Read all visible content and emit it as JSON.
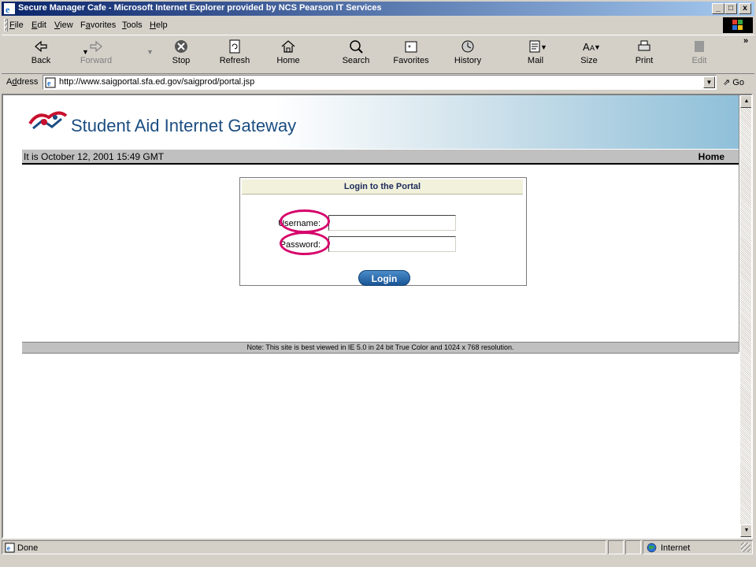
{
  "window": {
    "title": "Secure Manager Cafe - Microsoft Internet Explorer provided by NCS Pearson IT Services",
    "min": "_",
    "max": "□",
    "close": "x"
  },
  "menu": [
    {
      "label": "File",
      "accel": "F",
      "rest": "ile"
    },
    {
      "label": "Edit",
      "accel": "E",
      "rest": "dit"
    },
    {
      "label": "View",
      "accel": "V",
      "rest": "iew"
    },
    {
      "label": "Favorites",
      "accel": "a",
      "pre": "F",
      "rest": "vorites"
    },
    {
      "label": "Tools",
      "accel": "T",
      "rest": "ools"
    },
    {
      "label": "Help",
      "accel": "H",
      "rest": "elp"
    }
  ],
  "toolbar": {
    "back": "Back",
    "forward": "Forward",
    "stop": "Stop",
    "refresh": "Refresh",
    "home": "Home",
    "search": "Search",
    "favorites": "Favorites",
    "history": "History",
    "mail": "Mail",
    "size": "Size",
    "print": "Print",
    "edit": "Edit",
    "more": "»"
  },
  "address": {
    "label_pre": "A",
    "label_accel": "d",
    "label_post": "dress",
    "url": "http://www.saigportal.sfa.ed.gov/saigprod/portal.jsp",
    "go": "Go"
  },
  "site": {
    "title": "Student Aid Internet Gateway",
    "date": "It is October 12, 2001 15:49 GMT",
    "home": "Home"
  },
  "login": {
    "heading": "Login to the Portal",
    "username_label": "Username:",
    "password_label": "Password:",
    "username_value": "",
    "password_value": "",
    "button": "Login"
  },
  "note": "Note: This site is best viewed in IE 5.0 in 24 bit True Color and 1024 x 768 resolution.",
  "status": {
    "text": "Done",
    "zone": "Internet"
  },
  "colors": {
    "annotation": "#d6006a",
    "title_blue": "#1b4d82"
  }
}
